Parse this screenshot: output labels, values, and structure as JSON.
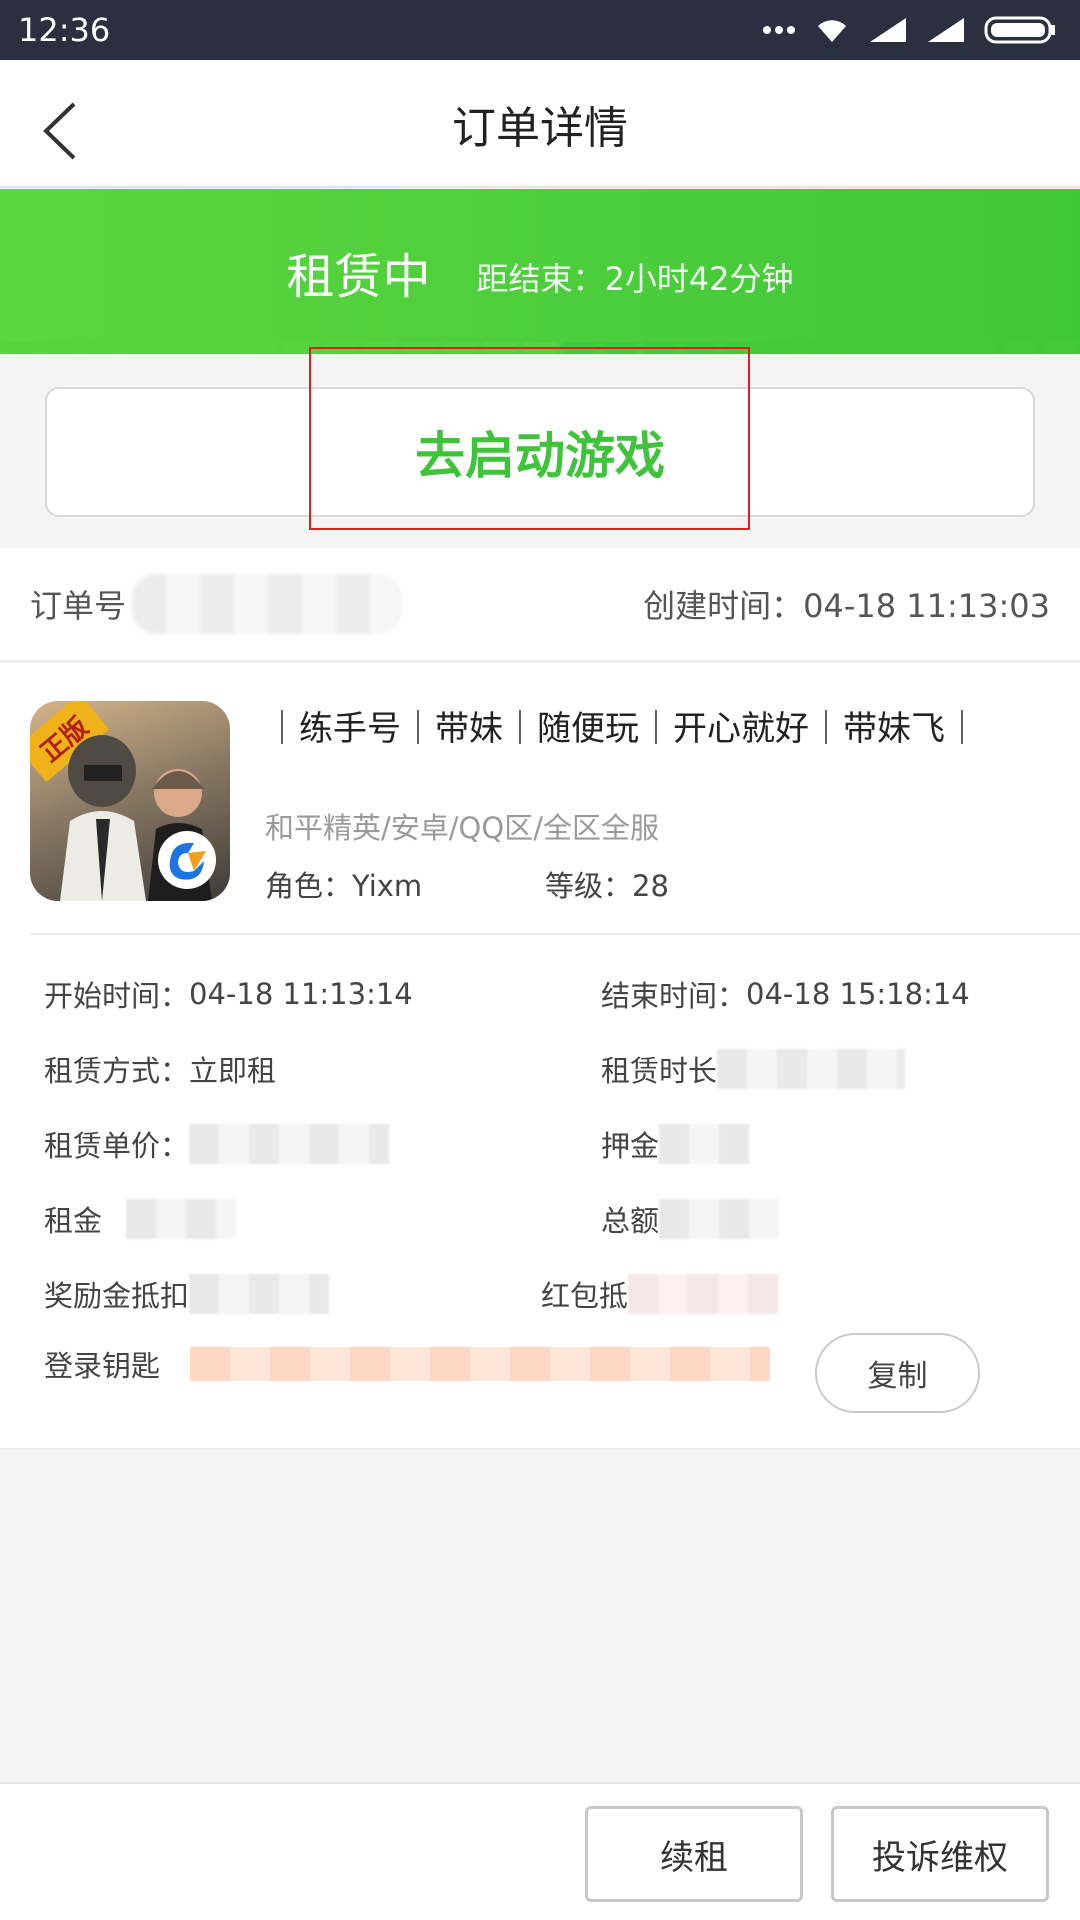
{
  "status_bar": {
    "time": "12:36"
  },
  "header": {
    "title": "订单详情"
  },
  "banner": {
    "status": "租赁中",
    "remaining": "距结束：2小时42分钟"
  },
  "launch": {
    "label": "去启动游戏"
  },
  "order": {
    "number_label": "订单号",
    "created_label": "创建时间：",
    "created_value": "04-18 11:13:03"
  },
  "product": {
    "thumb_badge": "正版",
    "listing_title": "｜练手号｜带妹｜随便玩｜开心就好｜带妹飞｜",
    "game_info": "和平精英/安卓/QQ区/全区全服",
    "role_label": "角色：",
    "role_value": "Yixm",
    "level_label": "等级：",
    "level_value": "28"
  },
  "details": {
    "start_label": "开始时间：",
    "start_value": "04-18 11:13:14",
    "end_label": "结束时间：",
    "end_value": "04-18 15:18:14",
    "method_label": "租赁方式：",
    "method_value": "立即租",
    "duration_label": "租赁时长",
    "unit_price_label": "租赁单价：",
    "deposit_label": "押金",
    "rent_label": "租金",
    "total_label": "总额",
    "reward_label": "奖励金抵扣",
    "redpacket_label": "红包抵",
    "login_key_label": "登录钥匙",
    "copy_label": "复制"
  },
  "bottom": {
    "renew_label": "续租",
    "complain_label": "投诉维权"
  },
  "colors": {
    "accent_green": "#3ec33a",
    "status_bar": "#2b2f3f",
    "highlight": "#e02020"
  },
  "icons": [
    "back-arrow-icon",
    "wifi-icon",
    "signal-icon",
    "battery-icon",
    "more-dots-icon"
  ]
}
